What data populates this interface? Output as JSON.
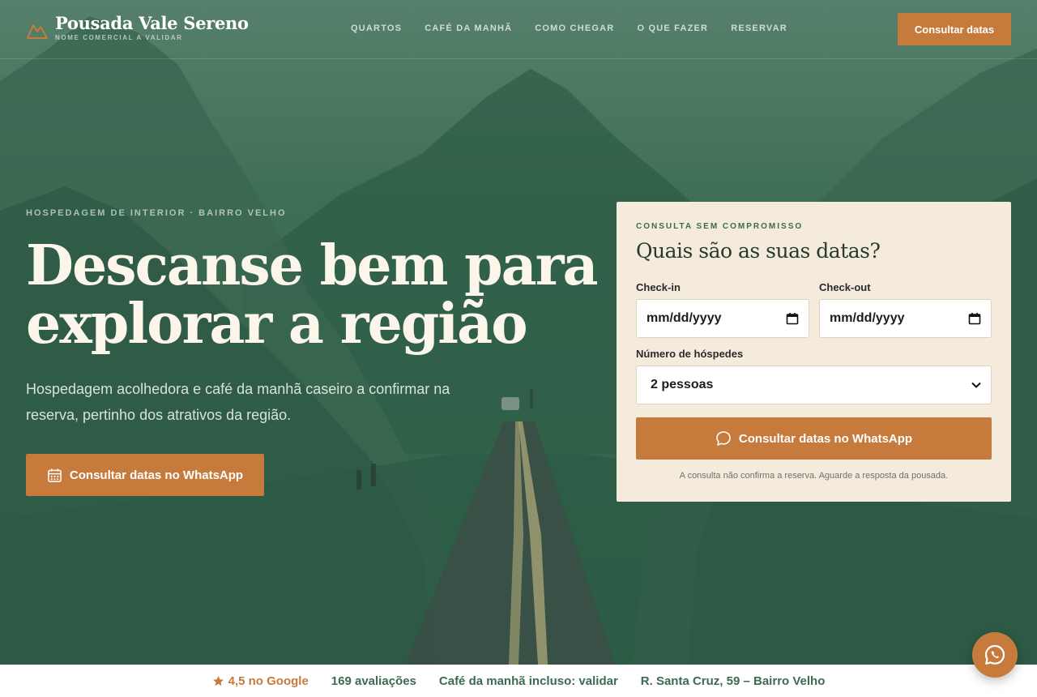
{
  "brand": {
    "name": "Pousada Vale Sereno",
    "subtitle": "NOME COMERCIAL A VALIDAR",
    "icon": "mountain-logo-icon"
  },
  "nav": {
    "items": [
      {
        "label": "QUARTOS"
      },
      {
        "label": "CAFÉ DA MANHÃ"
      },
      {
        "label": "COMO CHEGAR"
      },
      {
        "label": "O QUE FAZER"
      },
      {
        "label": "RESERVAR"
      }
    ],
    "cta_label": "Consultar datas"
  },
  "hero": {
    "eyebrow": "HOSPEDAGEM DE INTERIOR · BAIRRO VELHO",
    "headline_line1": "Descanse bem para",
    "headline_line2": "explorar a região",
    "lead": "Hospedagem acolhedora e café da manhã caseiro a confirmar na reserva, pertinho dos atrativos da região.",
    "cta_label": "Consultar datas no WhatsApp",
    "cta_icon": "calendar-icon"
  },
  "booking": {
    "eyebrow": "CONSULTA SEM COMPROMISSO",
    "title": "Quais são as suas datas?",
    "checkin_label": "Check-in",
    "checkin_placeholder": "mm/dd/yyyy",
    "checkout_label": "Check-out",
    "checkout_placeholder": "mm/dd/yyyy",
    "guests_label": "Número de hóspedes",
    "guests_value": "2 pessoas",
    "cta_label": "Consultar datas no WhatsApp",
    "cta_icon": "chat-bubble-icon",
    "note": "A consulta não confirma a reserva. Aguarde a resposta da pousada."
  },
  "infobar": {
    "rating": "4,5 no Google",
    "reviews": "169 avaliações",
    "breakfast": "Café da manhã incluso: validar",
    "address": "R. Santa Cruz, 59 – Bairro Velho"
  },
  "colors": {
    "accent": "#c67a3c",
    "green": "#3b6b52",
    "card_bg": "#f4ebdd",
    "hero_overlay": "#3f6e56"
  },
  "fab": {
    "icon": "whatsapp-icon"
  }
}
